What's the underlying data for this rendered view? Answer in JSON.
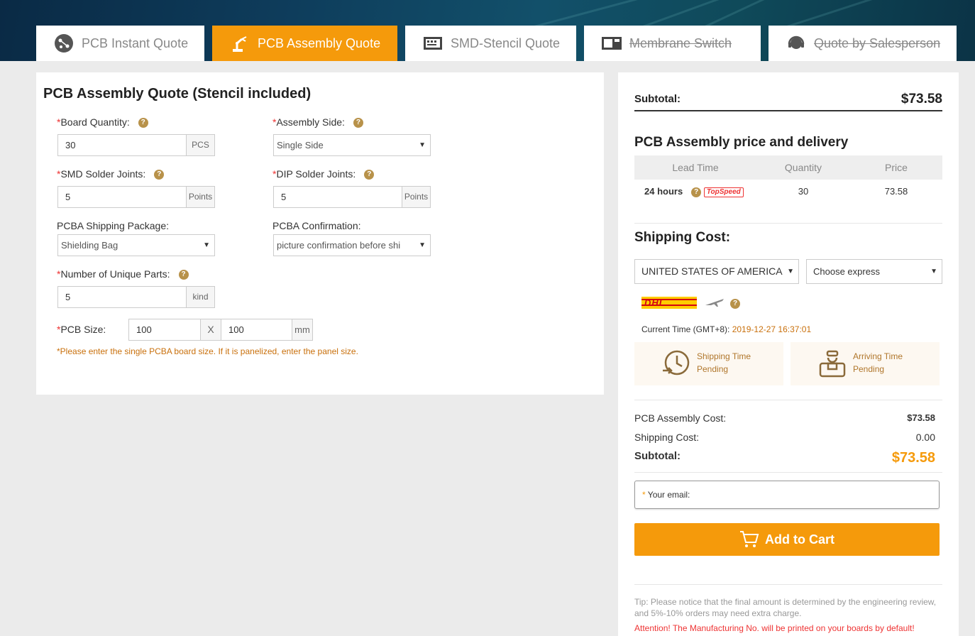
{
  "tabs": [
    {
      "label": "PCB Instant Quote",
      "icon": "pcb-icon"
    },
    {
      "label": "PCB Assembly Quote",
      "icon": "robot-arm-icon"
    },
    {
      "label": "SMD-Stencil Quote",
      "icon": "stencil-icon"
    },
    {
      "label": "Membrane Switch",
      "icon": "membrane-icon"
    },
    {
      "label": "Quote by Salesperson",
      "icon": "headset-icon"
    }
  ],
  "form": {
    "title": "PCB Assembly Quote (Stencil included)",
    "board_quantity": {
      "label": "Board Quantity:",
      "value": "30",
      "unit": "PCS"
    },
    "assembly_side": {
      "label": "Assembly Side:",
      "value": "Single Side"
    },
    "smd_joints": {
      "label": "SMD Solder Joints:",
      "value": "5",
      "unit": "Points"
    },
    "dip_joints": {
      "label": "DIP Solder Joints:",
      "value": "5",
      "unit": "Points"
    },
    "shipping_package": {
      "label": "PCBA Shipping Package:",
      "value": "Shielding Bag"
    },
    "confirmation": {
      "label": "PCBA Confirmation:",
      "value": "picture confirmation before shi"
    },
    "unique_parts": {
      "label": "Number of Unique Parts:",
      "value": "5",
      "unit": "kind"
    },
    "pcb_size": {
      "label": "PCB Size:",
      "width": "100",
      "height": "100",
      "sep": "X",
      "unit": "mm"
    },
    "note": "*Please enter the single PCBA board size. If it is panelized, enter the panel size.",
    "required_mark": "*",
    "help_mark": "?"
  },
  "summary": {
    "subtotal_label": "Subtotal:",
    "subtotal_value": "$73.58",
    "price_title": "PCB Assembly price and delivery",
    "table_headers": [
      "Lead Time",
      "Quantity",
      "Price"
    ],
    "lead_time": "24 hours",
    "topspeed": "TopSpeed",
    "quantity": "30",
    "price": "73.58",
    "shipping_title": "Shipping Cost:",
    "country": "UNITED STATES OF AMERICA",
    "express": "Choose express",
    "carrier": "DHL",
    "current_time_label": "Current Time (GMT+8):",
    "current_time": "2019-12-27 16:37:01",
    "shipping_time_label": "Shipping Time",
    "shipping_time_value": "Pending",
    "arriving_time_label": "Arriving Time",
    "arriving_time_value": "Pending",
    "assembly_cost_label": "PCB Assembly Cost:",
    "assembly_cost_value": "$73.58",
    "shipping_cost_label": "Shipping Cost:",
    "shipping_cost_value": "0.00",
    "subtotal2_label": "Subtotal:",
    "subtotal2_value": "$73.58",
    "email_label": "Your email:",
    "email_required": "*",
    "cart_button": "Add to Cart",
    "tip": "Tip: Please notice that the final amount is determined by the engineering review, and 5%-10% orders may need extra charge.",
    "attention": "Attention! The Manufacturing No. will be printed on your boards by default!"
  },
  "colors": {
    "accent": "#f59a0b",
    "note": "#c9700c",
    "help": "#b8924a",
    "danger": "#e33333"
  }
}
